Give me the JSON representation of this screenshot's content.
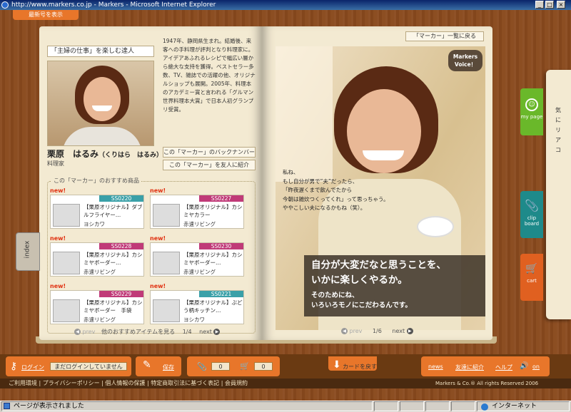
{
  "window": {
    "title": "http://www.markers.co.jp - Markers - Microsoft Internet Explorer",
    "min": "_",
    "max": "□",
    "close": "×"
  },
  "latest_tab": "最新号を表示",
  "chef": {
    "title": "「主婦の仕事」を楽しむ達人",
    "name": "栗原　はるみ",
    "reading": "（くりはら　はるみ）",
    "job": "料理家",
    "bio": "1947年、静岡県生まれ。結婚後、来客への手料理が評判となり料理家に。アイデアあふれるレシピで幅広い層から絶大な支持を獲得。ベストセラー多数、TV、雑誌での活躍の他、オリジナルショップも展開。2005年、料理本のアカデミー賞と言われる「グルマン世界料理本大賞」で日本人初グランプリ受賞。",
    "backnumber_btn": "この「マーカー」のバックナンバー",
    "share_btn": "この「マーカー」を友人に紹介"
  },
  "recommend": {
    "title": "この「マーカー」のおすすめ商品",
    "items": [
      {
        "badge": "new!",
        "code": "SS0220",
        "name": "【栗原オリジナル】ダブルフライヤー…",
        "brand": "ヨシカワ",
        "color": "#3aa0a8"
      },
      {
        "badge": "new!",
        "code": "SS0227",
        "name": "【栗原オリジナル】カシミヤカラー",
        "brand": "赤速リビング",
        "color": "#c03a78"
      },
      {
        "badge": "new!",
        "code": "SS0228",
        "name": "【栗原オリジナル】カシミヤボーダー…",
        "brand": "赤速リビング",
        "color": "#c03a78"
      },
      {
        "badge": "new!",
        "code": "SS0230",
        "name": "【栗原オリジナル】カシミヤボーダー…",
        "brand": "赤速リビング",
        "color": "#c03a78"
      },
      {
        "badge": "new!",
        "code": "SS0229",
        "name": "【栗原オリジナル】カシミヤボーダー　手袋",
        "brand": "赤速リビング",
        "color": "#c03a78"
      },
      {
        "badge": "new!",
        "code": "SS0221",
        "name": "【栗原オリジナル】ぶどう柄キッチン…",
        "brand": "ヨシカワ",
        "color": "#3aa0a8"
      }
    ],
    "prev": "prev",
    "more": "他のおすすめアイテムを見る",
    "page": "1/4",
    "next": "next"
  },
  "right_page": {
    "back_to_list": "「マーカー」一覧に戻る",
    "voice": "Markers Voice！",
    "quote_lines": [
      "私ね、",
      "もし自分が男で”夫”だったら、",
      "「昨夜遅くまで飲んでたから",
      "今朝は雑炊つくってくれ」って思っちゃう。",
      "ややこしい夫になるかもね（笑）。"
    ],
    "headline_lines": [
      "自分が大変だなと思うことを、",
      "いかに楽しくやるか。"
    ],
    "subline_lines": [
      "そのためにね、",
      "いろいろモノにこだわるんです。"
    ],
    "prev": "prev",
    "page": "1/6",
    "next": "next"
  },
  "index_tab": "index",
  "right_tabs": {
    "mypage": "my page",
    "clipboard": "clip board",
    "cart": "cart",
    "side_text": "気にリアコ"
  },
  "bottom": {
    "login": "ログイン",
    "login_status": "まだログインしていません",
    "save": "保存",
    "clip_count": "0",
    "cart_count": "0",
    "return_card": "カードを戻す",
    "news": "news",
    "invite": "友達に紹介",
    "help": "ヘルプ",
    "sound": "on"
  },
  "footer": {
    "links": [
      "ご利用環境",
      "プライバシーポリシー",
      "個人情報の保護",
      "特定商取引法に基づく表記",
      "会員規約"
    ],
    "copyright": "Markers & Co.® All rights Reserved 2006"
  },
  "status": {
    "text": "ページが表示されました",
    "zone": "インターネット"
  }
}
